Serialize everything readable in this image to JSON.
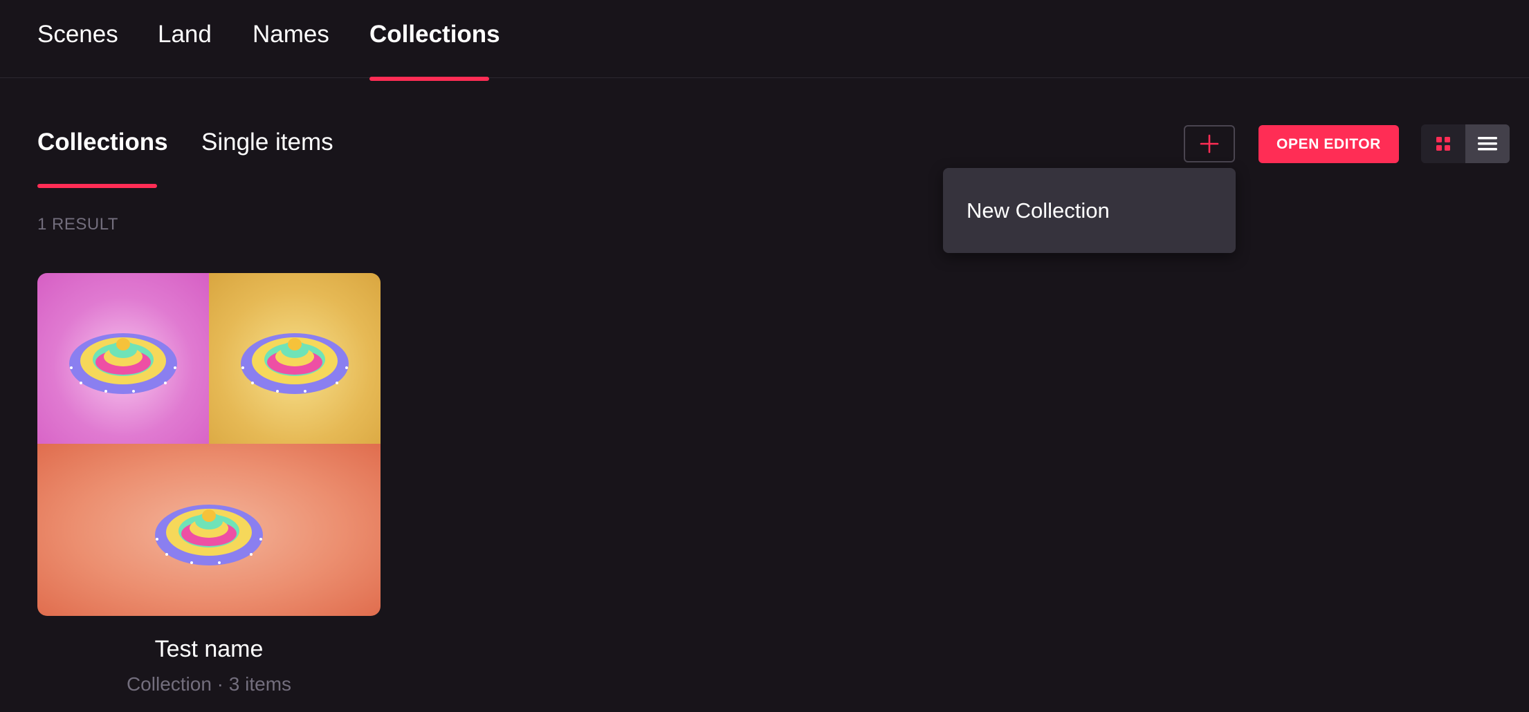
{
  "top_nav": {
    "tabs": [
      {
        "label": "Scenes"
      },
      {
        "label": "Land"
      },
      {
        "label": "Names"
      },
      {
        "label": "Collections"
      }
    ],
    "active": "Collections"
  },
  "sub_nav": {
    "tabs": [
      {
        "label": "Collections"
      },
      {
        "label": "Single items"
      }
    ],
    "active": "Collections"
  },
  "results_label": "1 RESULT",
  "toolbar": {
    "add_icon": "plus-icon",
    "open_editor_label": "OPEN EDITOR",
    "view_grid_icon": "grid-icon",
    "view_list_icon": "list-icon",
    "active_view": "list"
  },
  "dropdown": {
    "items": [
      {
        "label": "New Collection"
      }
    ]
  },
  "collection_card": {
    "title": "Test name",
    "meta": "Collection · 3 items",
    "thumbnail_backgrounds": [
      "pink",
      "yellow",
      "orange"
    ]
  },
  "colors": {
    "accent": "#ff2d55",
    "background": "#18141a",
    "muted_text": "#736e7d",
    "dropdown_bg": "#36333d"
  }
}
